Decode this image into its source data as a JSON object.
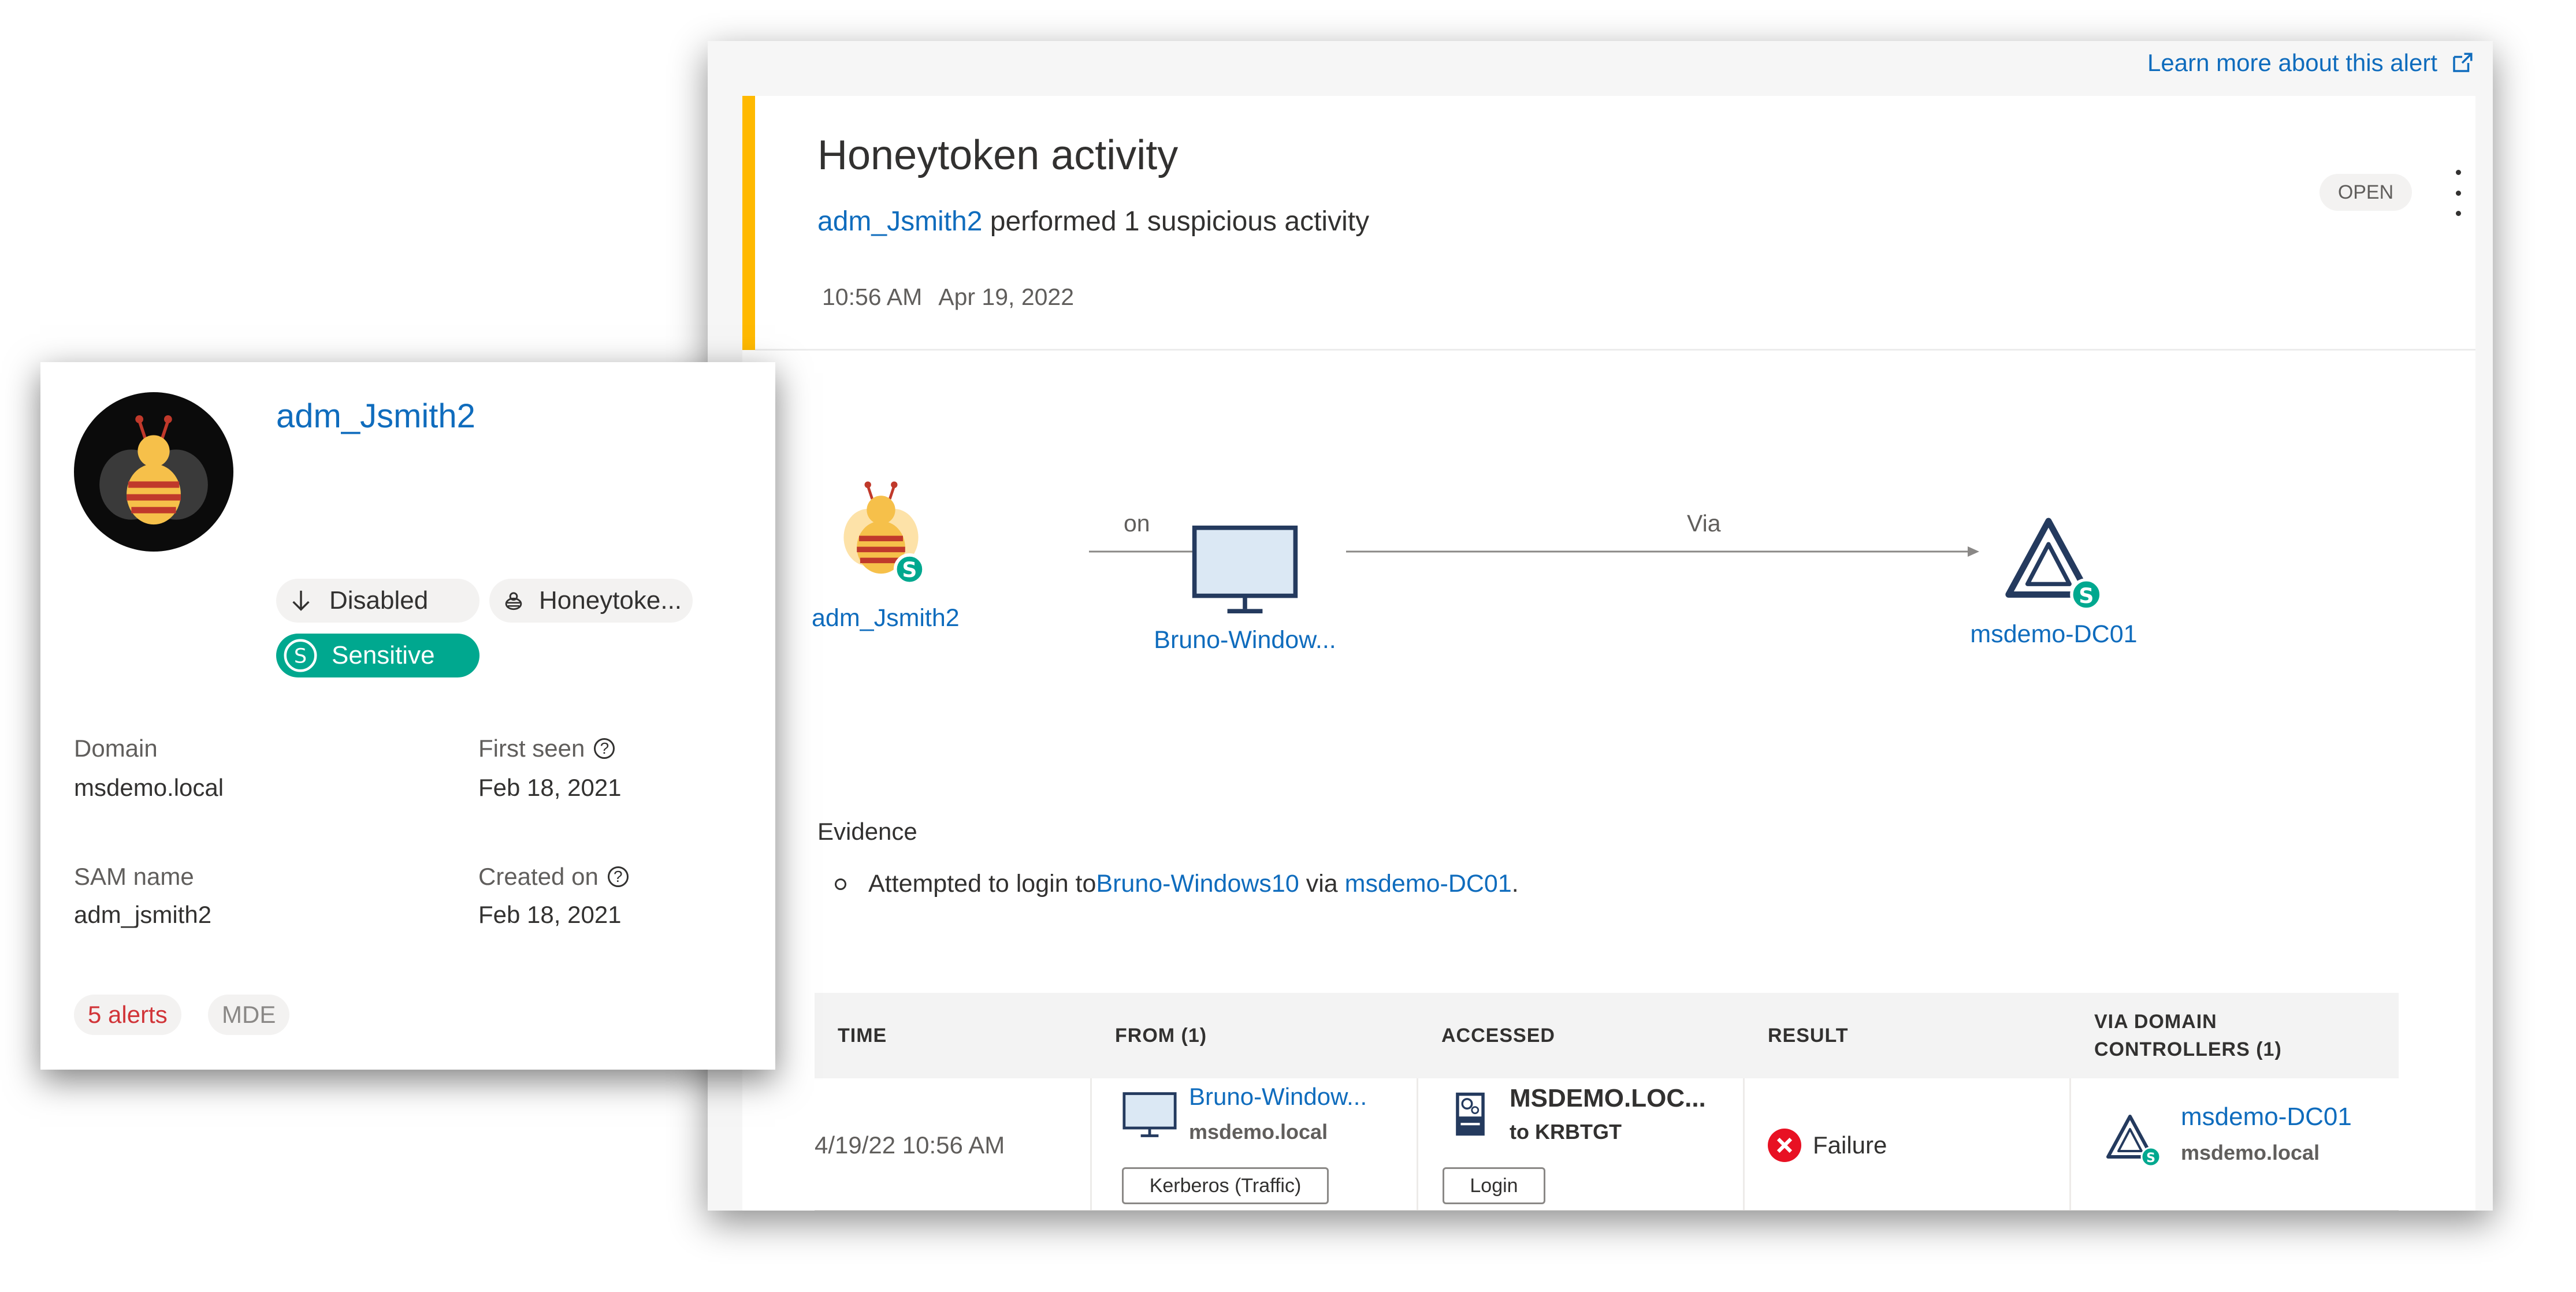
{
  "alert": {
    "learn_more": "Learn more about this alert",
    "title": "Honeytoken activity",
    "subtitle_user": "adm_Jsmith2",
    "subtitle_rest": " performed 1 suspicious activity",
    "time": "10:56 AM",
    "date": "Apr 19, 2022",
    "status": "OPEN"
  },
  "graph": {
    "source": "adm_Jsmith2",
    "edge1": "on",
    "target": "Bruno-Window...",
    "edge2": "Via",
    "via": "msdemo-DC01"
  },
  "evidence": {
    "heading": "Evidence",
    "prefix": "Attempted to login to ",
    "target_link": "Bruno-Windows10",
    "middle": " via ",
    "via_link": "msdemo-DC01",
    "suffix": "."
  },
  "table": {
    "headers": [
      "TIME",
      "FROM (1)",
      "ACCESSED",
      "RESULT",
      "VIA DOMAIN CONTROLLERS (1)"
    ],
    "row": {
      "time": "4/19/22 10:56 AM",
      "from_name": "Bruno-Window...",
      "from_domain": "msdemo.local",
      "from_protocol": "Kerberos (Traffic)",
      "accessed_name": "MSDEMO.LOC...",
      "accessed_sub": "to KRBTGT",
      "accessed_action": "Login",
      "result": "Failure",
      "via_name": "msdemo-DC01",
      "via_domain": "msdemo.local"
    }
  },
  "user_card": {
    "name": "adm_Jsmith2",
    "tags": {
      "disabled": "Disabled",
      "honeytoken": "Honeytoke...",
      "sensitive": "Sensitive"
    },
    "domain_label": "Domain",
    "domain_value": "msdemo.local",
    "first_seen_label": "First seen",
    "first_seen_value": "Feb 18, 2021",
    "sam_label": "SAM name",
    "sam_value": "adm_jsmith2",
    "created_label": "Created on",
    "created_value": "Feb 18, 2021",
    "alerts_pill": "5 alerts",
    "mde_pill": "MDE"
  },
  "colors": {
    "accent": "#0f6cbd",
    "stripe": "#ffb900",
    "sensitive": "#00a88f",
    "failure": "#e81123",
    "alerts": "#d13438"
  },
  "icons": [
    "external-link-icon",
    "more-vertical-icon",
    "bee-user-icon",
    "monitor-icon",
    "domain-controller-icon",
    "arrow-right-icon",
    "sensitive-s-icon",
    "arrow-down-icon",
    "honeytoken-icon",
    "help-icon",
    "server-icon",
    "failure-x-icon"
  ]
}
